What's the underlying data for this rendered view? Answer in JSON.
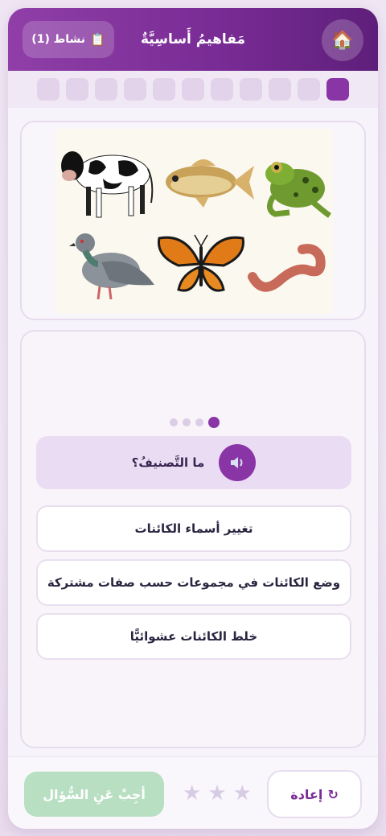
{
  "header": {
    "badge_label": "نشاط (1)",
    "badge_icon": "clipboard-icon",
    "title": "مَفاهيمُ أَساسِيَّةٌ",
    "home_icon": "home-icon"
  },
  "progress": {
    "total_steps": 11,
    "current_step": 1
  },
  "image_card": {
    "animals": [
      "cow",
      "fish",
      "frog",
      "pigeon",
      "butterfly",
      "earthworm"
    ]
  },
  "question": {
    "page_dots": 4,
    "active_dot": 4,
    "text": "ما التَّصنيفُ؟",
    "speaker_icon": "speaker-icon"
  },
  "options": [
    {
      "label": "تغيير أسماء الكائنات"
    },
    {
      "label": "وضع الكائنات في مجموعات حسب صفات مشتركة"
    },
    {
      "label": "خلط الكائنات عشوائيًّا"
    }
  ],
  "footer": {
    "answer_label": "أجِبْ عَنِ السُّؤال",
    "stars_earned": 0,
    "stars_total": 3,
    "retry_label": "إعادة",
    "retry_icon": "↻"
  },
  "colors": {
    "accent": "#8a35a6",
    "header_start": "#8f3fa7",
    "header_end": "#5e1f7a",
    "answer_button": "#b8dfc2",
    "star_empty": "#d8cce4"
  }
}
